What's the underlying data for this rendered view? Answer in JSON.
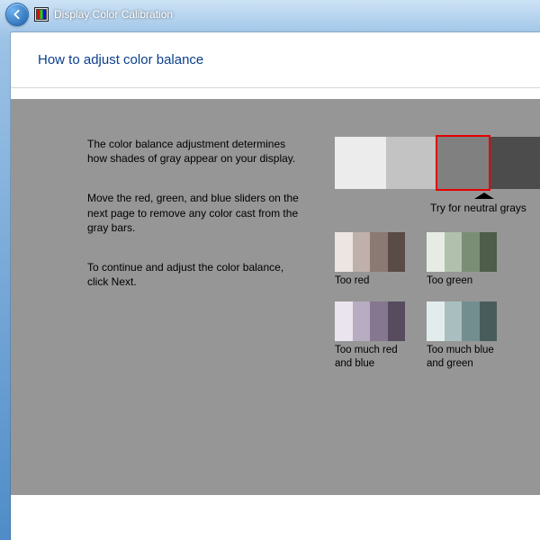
{
  "window": {
    "title": "Display Color Calibration"
  },
  "header": {
    "heading": "How to adjust color balance"
  },
  "body": {
    "para1": "The color balance adjustment determines how shades of gray appear on your display.",
    "para2": "Move the red, green, and blue sliders on the next page to remove any color cast from the gray bars.",
    "para3": "To continue and adjust the color balance, click Next."
  },
  "hint": "Try for neutral grays",
  "thumbs": {
    "too_red": "Too red",
    "too_green": "Too green",
    "too_rb": "Too much red and blue",
    "too_bg": "Too much blue and green"
  }
}
